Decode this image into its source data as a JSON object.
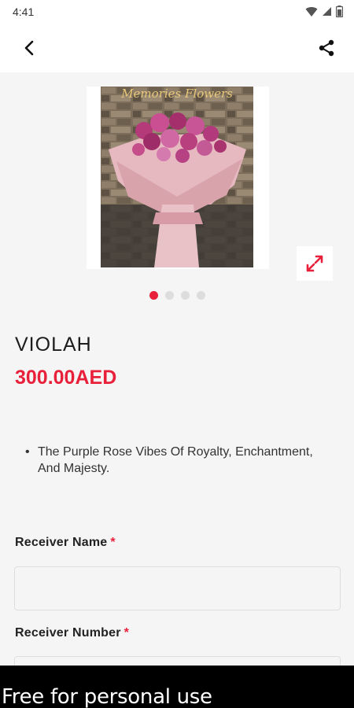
{
  "status_bar": {
    "time": "4:41",
    "icons": [
      "wifi-icon",
      "cell-signal-icon",
      "battery-icon"
    ]
  },
  "app_bar": {
    "back_icon": "chevron-left-icon",
    "share_icon": "share-icon"
  },
  "gallery": {
    "image_caption": "Memories Flowers",
    "image_count": 4,
    "active_index": 0,
    "expand_icon": "expand-icon"
  },
  "product": {
    "name": "VIOLAH",
    "price": "300.00AED",
    "description_bullet": "•",
    "description": "The Purple Rose Vibes Of Royalty, Enchantment, And Majesty."
  },
  "form": {
    "receiver_name_label": "Receiver Name",
    "receiver_name_value": "",
    "receiver_number_label": "Receiver Number",
    "receiver_number_value": "",
    "required_mark": "*"
  },
  "watermark": {
    "text": "Free for personal use"
  },
  "colors": {
    "accent": "#e8203a",
    "background": "#f5f5f5"
  }
}
